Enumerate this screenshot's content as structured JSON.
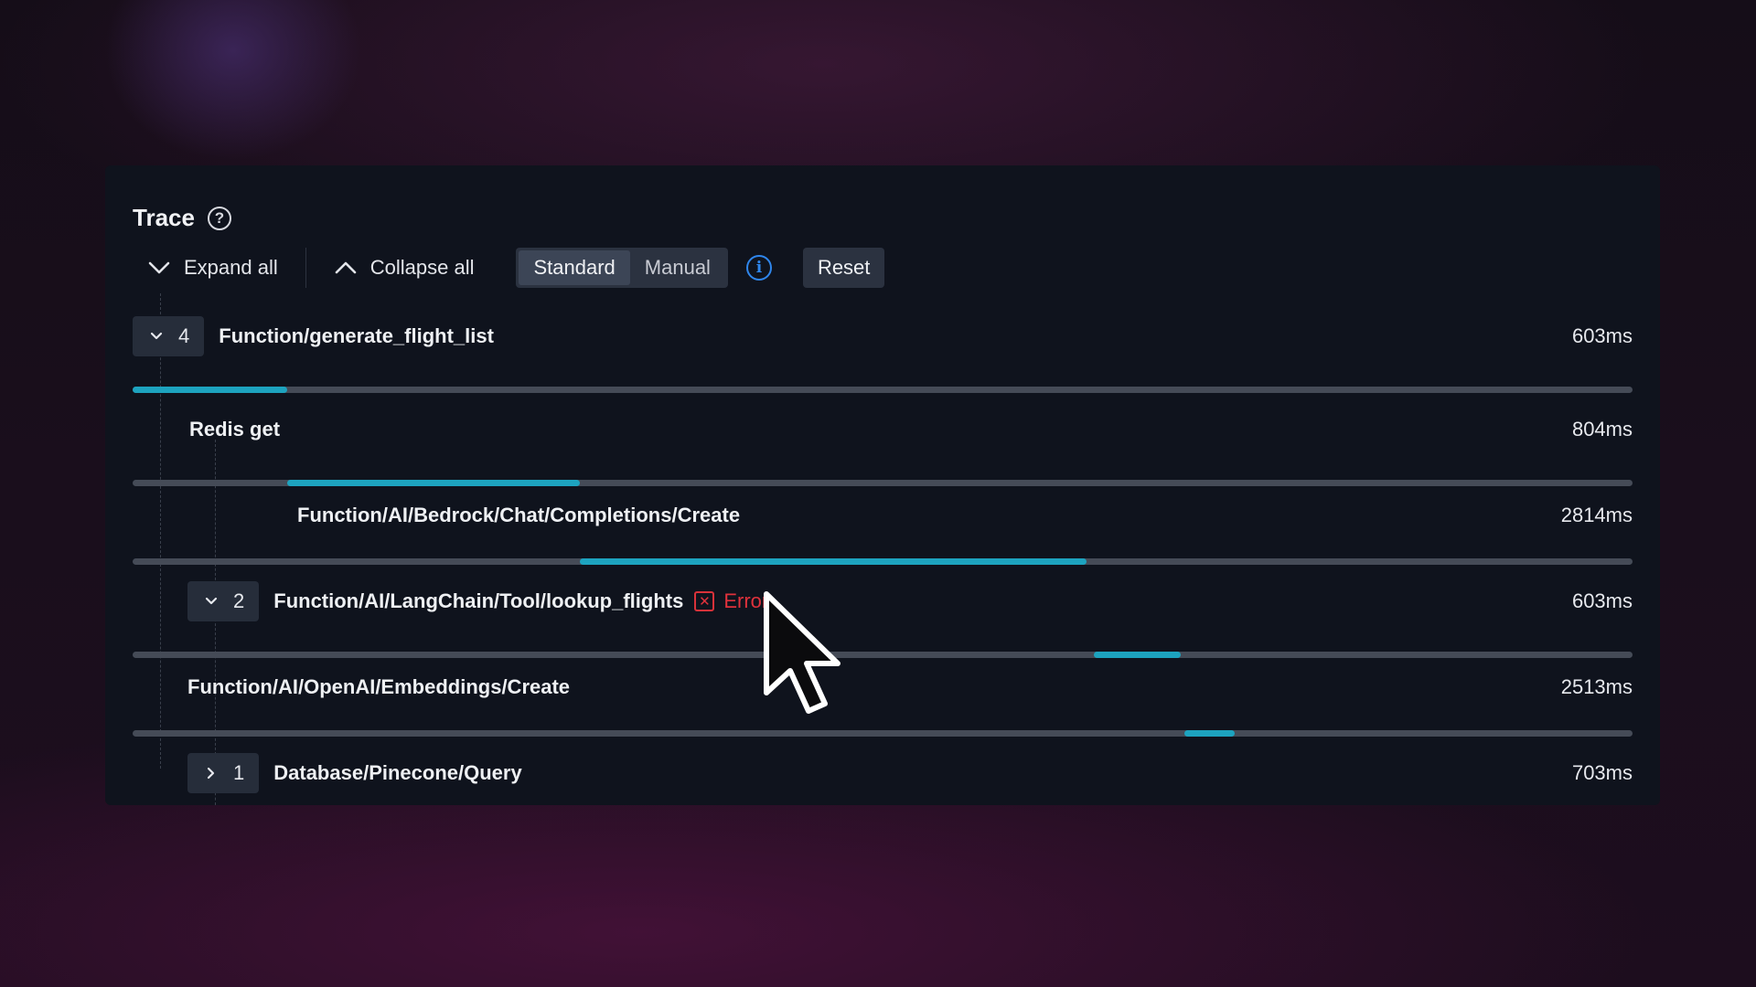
{
  "trace": {
    "title": "Trace",
    "toolbar": {
      "expand_all": "Expand all",
      "collapse_all": "Collapse all",
      "modes": [
        "Standard",
        "Manual"
      ],
      "active_mode": "Standard",
      "reset": "Reset"
    },
    "spans": [
      {
        "name": "Function/generate_flight_list",
        "count": "4",
        "expanded": true,
        "duration": "603ms",
        "start": 0.0,
        "end": 0.103
      },
      {
        "name": "Redis get",
        "duration": "804ms",
        "start": 0.103,
        "end": 0.298
      },
      {
        "name": "Function/AI/Bedrock/Chat/Completions/Create",
        "duration": "2814ms",
        "start": 0.298,
        "end": 0.636
      },
      {
        "name": "Function/AI/LangChain/Tool/lookup_flights",
        "count": "2",
        "expanded": true,
        "duration": "603ms",
        "status": "Error",
        "start": 0.641,
        "end": 0.699
      },
      {
        "name": "Function/AI/OpenAI/Embeddings/Create",
        "duration": "2513ms",
        "start": 0.701,
        "end": 0.735
      },
      {
        "name": "Database/Pinecone/Query",
        "count": "1",
        "expanded": false,
        "duration": "703ms"
      }
    ]
  },
  "colors": {
    "accent": "#1da3bf",
    "error": "#e0323c",
    "info": "#2f86ec",
    "panel": "#0f131d"
  },
  "icons": {
    "help": "help-circle-icon",
    "expand": "chevron-down-icon",
    "collapse": "chevron-up-icon",
    "info": "info-circle-icon",
    "error": "error-x-icon",
    "collapsed_toggle": "chevron-right-icon"
  }
}
